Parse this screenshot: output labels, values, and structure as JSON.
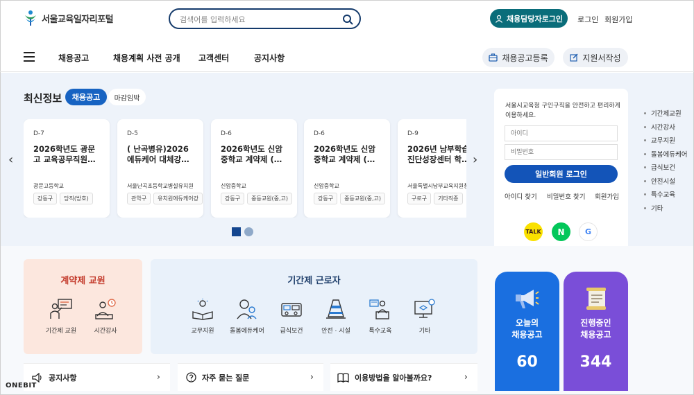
{
  "header": {
    "logo_text": "서울교육일자리포털",
    "search_placeholder": "검색어를 입력하세요",
    "recruit_login": "채용담당자로그인",
    "login": "로그인",
    "signup": "회원가입"
  },
  "nav": {
    "items": [
      "채용공고",
      "채용계획 사전 공개",
      "고객센터",
      "공지사항"
    ],
    "register_btn": "채용공고등록",
    "apply_btn": "지원서작성"
  },
  "latest": {
    "title": "최신정보",
    "tab_active": "채용공고",
    "tab_inactive": "마감임박",
    "cards": [
      {
        "dday": "D-7",
        "title1": "2026학년도 광문",
        "title2": "고 교육공무직원…",
        "org": "광문고등학교",
        "tags": [
          "강동구",
          "당직(방호)"
        ]
      },
      {
        "dday": "D-5",
        "title1": "( 난곡병유)2026",
        "title2": "에듀케어 대체강…",
        "org": "서울난곡초등학교병설유치원",
        "tags": [
          "관악구",
          "유치원에듀케어강"
        ]
      },
      {
        "dday": "D-6",
        "title1": "2026학년도 신암",
        "title2": "중학교 계약제 (…",
        "org": "신암중학교",
        "tags": [
          "강동구",
          "중등교원(중,고)"
        ]
      },
      {
        "dday": "D-6",
        "title1": "2026학년도 신암",
        "title2": "중학교 계약제 (…",
        "org": "신암중학교",
        "tags": [
          "강동구",
          "중등교원(중,고)"
        ]
      },
      {
        "dday": "D-9",
        "title1": "2026년 남부학습",
        "title2": "진단성장센터 학…",
        "org": "서울특별시남부교육지원청",
        "tags": [
          "구로구",
          "기타직종"
        ]
      }
    ]
  },
  "login_box": {
    "desc": "서울시교육청 구인구직을 안전하고 편리하게 이용하세요.",
    "id_placeholder": "아이디",
    "pw_placeholder": "비밀번호",
    "login_btn": "일반회원 로그인",
    "find_id": "아이디 찾기",
    "find_pw": "비밀번호 찾기",
    "signup": "회원가입",
    "social": [
      "TALK",
      "N",
      "G"
    ]
  },
  "side_list": [
    "기간제교원",
    "시간강사",
    "교무지원",
    "돌봄에듀케어",
    "급식보건",
    "안전시설",
    "특수교육",
    "기타"
  ],
  "contract": {
    "title": "계약제 교원",
    "items": [
      "기간제 교원",
      "시간강사"
    ]
  },
  "fixed_term": {
    "title": "기간제 근로자",
    "items": [
      "교무지원",
      "돌봄에듀케어",
      "급식보건",
      "안전 · 시설",
      "특수교육",
      "기타"
    ]
  },
  "stats": {
    "today_label": "오늘의\n채용공고",
    "today_count": "60",
    "ongoing_label": "진행중인\n채용공고",
    "ongoing_count": "344",
    "colors": {
      "today": "#1a6fe0",
      "ongoing": "#7a4ed8"
    }
  },
  "infobar": {
    "notice": "공지사항",
    "faq": "자주 묻는 질문",
    "guide": "이용방법을 알아볼까요?"
  },
  "brand": "ONEBIT"
}
